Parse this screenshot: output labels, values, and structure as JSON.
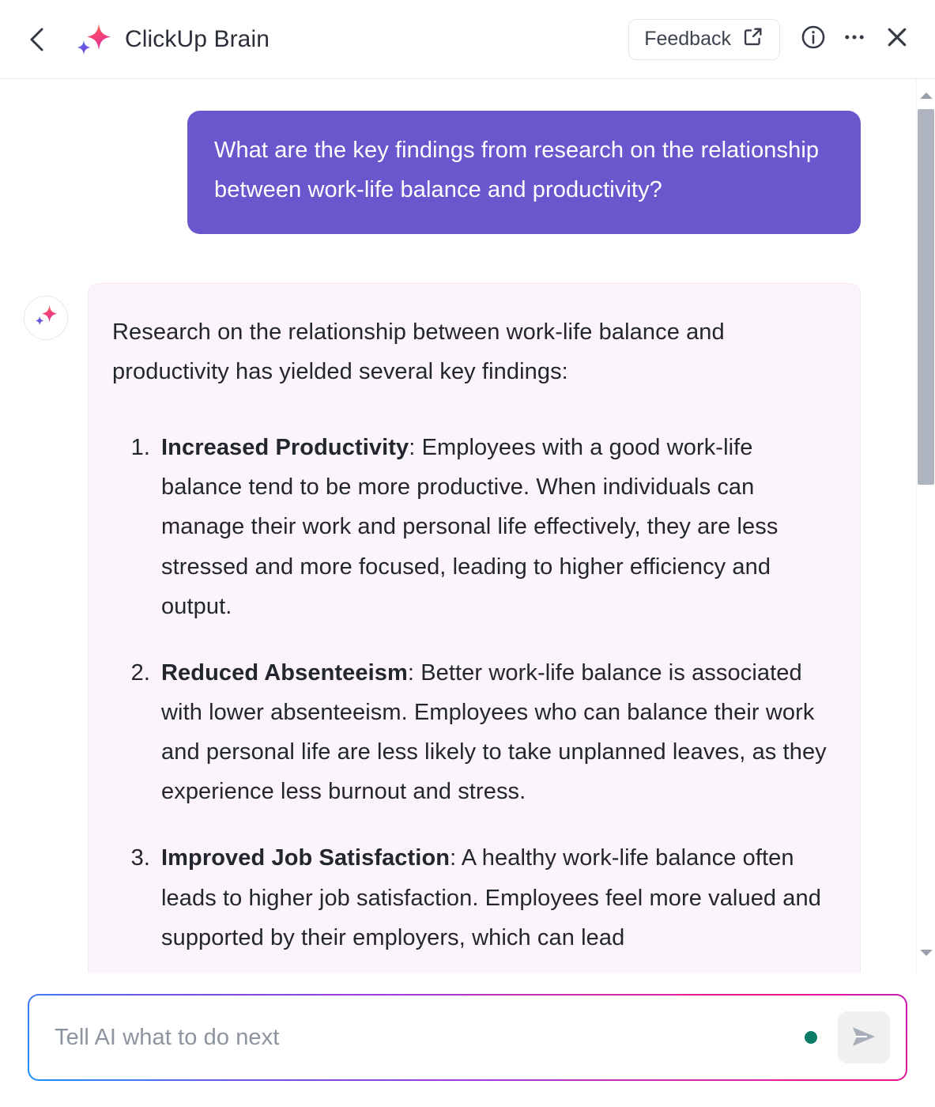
{
  "header": {
    "back_icon": "chevron-left-icon",
    "brand_icon": "sparkle-icon",
    "title": "ClickUp Brain",
    "feedback_label": "Feedback",
    "feedback_icon": "external-link-icon",
    "info_icon": "info-circle-icon",
    "more_icon": "ellipsis-icon",
    "close_icon": "close-icon"
  },
  "conversation": {
    "user_message": "What are the key findings from research on the relationship between work-life balance and productivity?",
    "assistant_avatar_icon": "sparkle-icon",
    "assistant_intro": "Research on the relationship between work-life balance and productivity has yielded several key findings:",
    "assistant_list": [
      {
        "number": "1.",
        "heading": "Increased Productivity",
        "body": ": Employees with a good work-life balance tend to be more productive. When individuals can manage their work and personal life effectively, they are less stressed and more focused, leading to higher efficiency and output."
      },
      {
        "number": "2.",
        "heading": "Reduced Absenteeism",
        "body": ": Better work-life balance is associated with lower absenteeism. Employees who can balance their work and personal life are less likely to take unplanned leaves, as they experience less burnout and stress."
      },
      {
        "number": "3.",
        "heading": "Improved Job Satisfaction",
        "body": ": A healthy work-life balance often leads to higher job satisfaction. Employees feel more valued and supported by their employers, which can lead"
      }
    ]
  },
  "scrollbar": {
    "up_arrow_icon": "caret-up-icon",
    "down_arrow_icon": "caret-down-icon",
    "thumb": "scrollbar-thumb"
  },
  "composer": {
    "placeholder": "Tell AI what to do next",
    "value": "",
    "status_dot": "status-dot",
    "send_icon": "send-icon"
  },
  "colors": {
    "user_bubble": "#6B56CE",
    "assistant_bubble": "#FBF4FB",
    "assistant_bubble_border": "#F6E6F5",
    "status_dot": "#0B7A66",
    "scrollbar_thumb": "#AEB4BF",
    "send_button_bg": "#F0F0F1"
  }
}
